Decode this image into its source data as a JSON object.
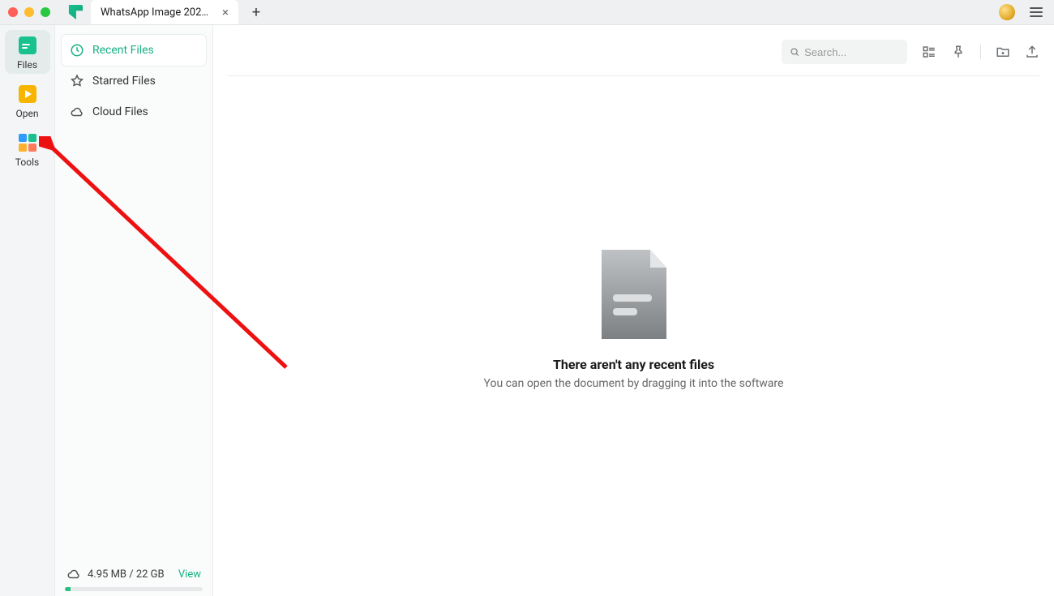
{
  "tab": {
    "title": "WhatsApp Image 2024-0…"
  },
  "rail": {
    "files": "Files",
    "open": "Open",
    "tools": "Tools"
  },
  "sidepanel": {
    "recent": "Recent Files",
    "starred": "Starred Files",
    "cloud": "Cloud Files"
  },
  "storage": {
    "usage": "4.95 MB / 22 GB",
    "view": "View"
  },
  "toolbar": {
    "search_placeholder": "Search..."
  },
  "empty": {
    "title": "There aren't any recent files",
    "subtitle": "You can open the document by dragging it into the software"
  }
}
